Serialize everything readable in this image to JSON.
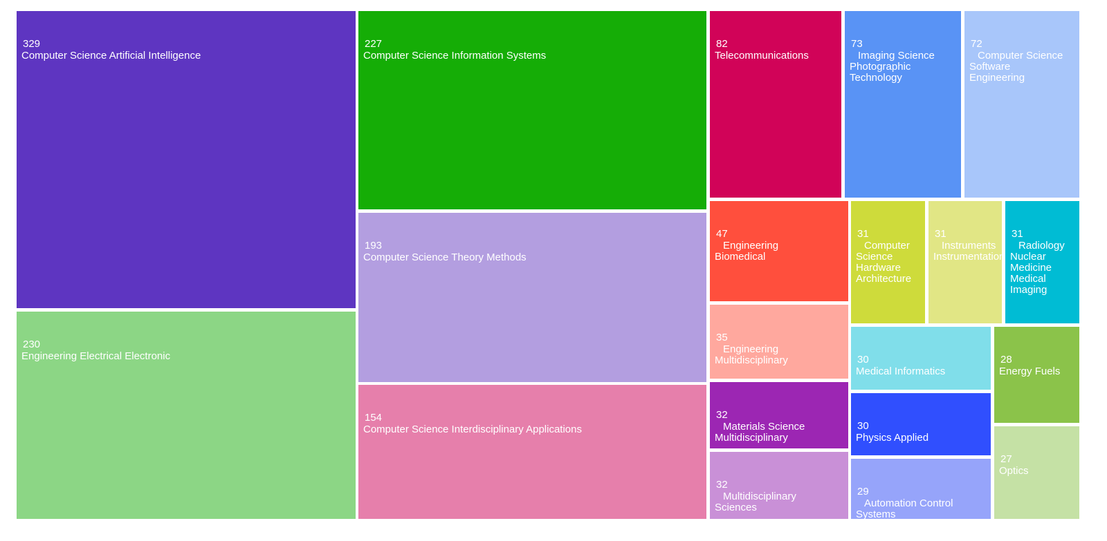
{
  "chart_data": {
    "type": "treemap",
    "tiles": [
      {
        "value": 329,
        "label": "Computer Science Artificial Intelligence",
        "lines": [
          "Computer Science Artificial Intelligence"
        ],
        "color": "#5e35c1"
      },
      {
        "value": 230,
        "label": "Engineering Electrical Electronic",
        "lines": [
          "Engineering Electrical Electronic"
        ],
        "color": "#8cd685"
      },
      {
        "value": 227,
        "label": "Computer Science Information Systems",
        "lines": [
          "Computer Science Information Systems"
        ],
        "color": "#15ad06"
      },
      {
        "value": 193,
        "label": "Computer Science Theory Methods",
        "lines": [
          "Computer Science Theory Methods"
        ],
        "color": "#b39ee0"
      },
      {
        "value": 154,
        "label": "Computer Science Interdisciplinary Applications",
        "lines": [
          "Computer Science Interdisciplinary Applications"
        ],
        "color": "#e67fab"
      },
      {
        "value": 82,
        "label": "Telecommunications",
        "lines": [
          "Telecommunications"
        ],
        "color": "#d10358"
      },
      {
        "value": 73,
        "label": "Imaging Science Photographic Technology",
        "lines": [
          "Imaging Science",
          "Photographic",
          "Technology"
        ],
        "color": "#5993f5"
      },
      {
        "value": 72,
        "label": "Computer Science Software Engineering",
        "lines": [
          "Computer Science",
          "Software",
          "Engineering"
        ],
        "color": "#a8c6fa"
      },
      {
        "value": 47,
        "label": "Engineering Biomedical",
        "lines": [
          "Engineering",
          "Biomedical"
        ],
        "color": "#ff4f3d"
      },
      {
        "value": 35,
        "label": "Engineering Multidisciplinary",
        "lines": [
          "Engineering",
          "Multidisciplinary"
        ],
        "color": "#ffa89e"
      },
      {
        "value": 32,
        "label": "Materials Science Multidisciplinary",
        "lines": [
          "Materials Science",
          "Multidisciplinary"
        ],
        "color": "#9c26b3"
      },
      {
        "value": 32,
        "label": "Multidisciplinary Sciences",
        "lines": [
          "Multidisciplinary",
          "Sciences"
        ],
        "color": "#c990d7"
      },
      {
        "value": 31,
        "label": "Computer Science Hardware Architecture",
        "lines": [
          "Computer",
          "Science",
          "Hardware",
          "Architecture"
        ],
        "color": "#cedb3b"
      },
      {
        "value": 31,
        "label": "Instruments Instrumentation",
        "lines": [
          "Instruments",
          "Instrumentation"
        ],
        "color": "#e1e685"
      },
      {
        "value": 31,
        "label": "Radiology Nuclear Medicine Medical Imaging",
        "lines": [
          "Radiology",
          "Nuclear",
          "Medicine",
          "Medical",
          "Imaging"
        ],
        "color": "#00bcd4"
      },
      {
        "value": 30,
        "label": "Medical Informatics",
        "lines": [
          "Medical Informatics"
        ],
        "color": "#80deea"
      },
      {
        "value": 30,
        "label": "Physics Applied",
        "lines": [
          "Physics Applied"
        ],
        "color": "#304ffe"
      },
      {
        "value": 29,
        "label": "Automation Control Systems",
        "lines": [
          "Automation Control",
          "Systems"
        ],
        "color": "#96a4fa"
      },
      {
        "value": 28,
        "label": "Energy Fuels",
        "lines": [
          "Energy Fuels"
        ],
        "color": "#8bc34a"
      },
      {
        "value": 27,
        "label": "Optics",
        "lines": [
          "Optics"
        ],
        "color": "#c5e1a5"
      }
    ]
  }
}
